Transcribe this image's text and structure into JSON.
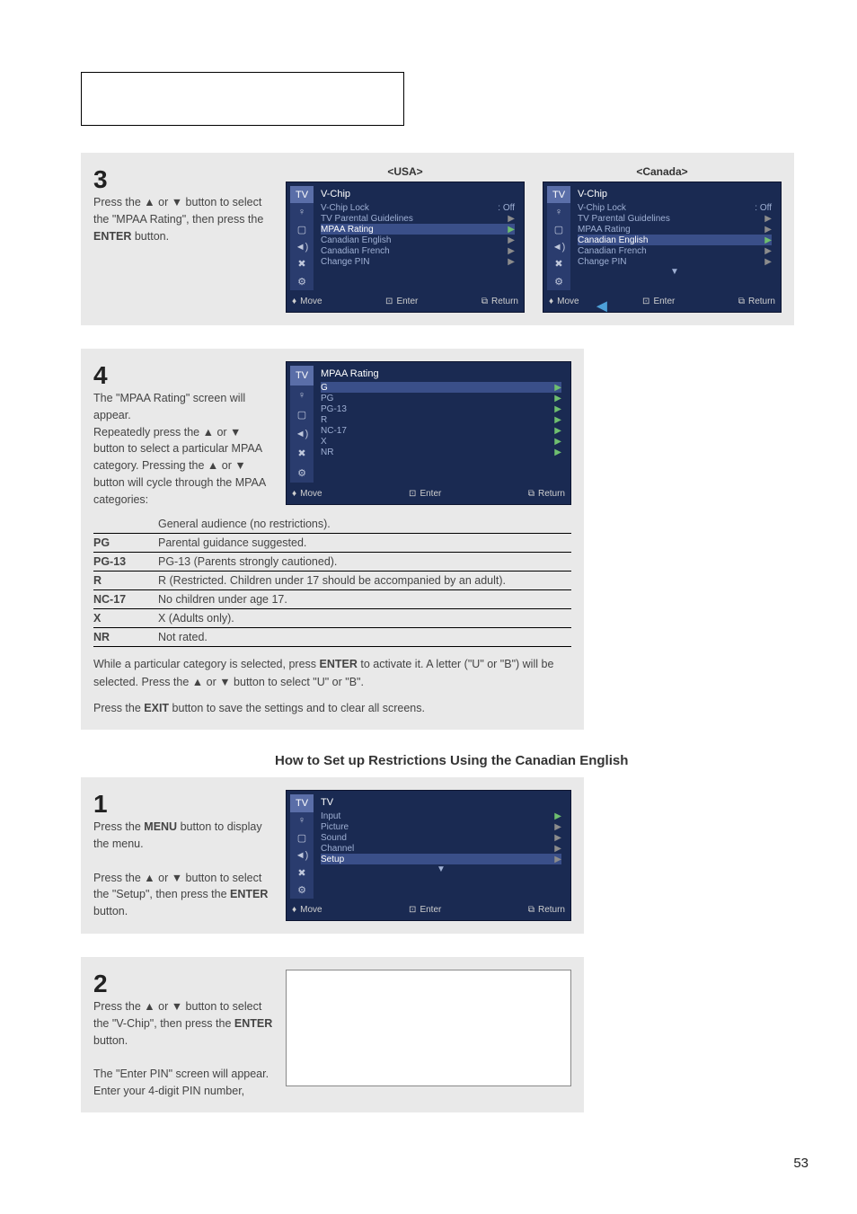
{
  "top_box": "",
  "step3": {
    "num": "3",
    "text_parts": [
      "Press the ▲ or ▼ button to select the \"MPAA Rating\", then press the ",
      " button."
    ],
    "bold": "ENTER",
    "usa_label": "<USA>",
    "canada_label": "<Canada>",
    "osd_usa": {
      "side_active": "TV",
      "title": "V-Chip",
      "lines": [
        {
          "l": "V-Chip Lock",
          "r": ": Off"
        },
        {
          "l": "TV Parental Guidelines",
          "r": "▶",
          "arrow": true
        },
        {
          "l": "MPAA Rating",
          "r": "▶",
          "sel": true,
          "arrow": true,
          "green": true
        },
        {
          "l": "Canadian English",
          "r": "▶",
          "arrow": true
        },
        {
          "l": "Canadian French",
          "r": "▶",
          "arrow": true
        },
        {
          "l": "Change PIN",
          "r": "▶",
          "arrow": true
        }
      ],
      "bottom": {
        "move": "Move",
        "enter": "Enter",
        "return": "Return"
      }
    },
    "osd_canada": {
      "side_active": "TV",
      "title": "V-Chip",
      "lines": [
        {
          "l": "V-Chip Lock",
          "r": ": Off"
        },
        {
          "l": "TV Parental Guidelines",
          "r": "▶",
          "arrow": true
        },
        {
          "l": "MPAA Rating",
          "r": "▶",
          "arrow": true
        },
        {
          "l": "Canadian English",
          "r": "▶",
          "sel": true,
          "arrow": true,
          "green": true
        },
        {
          "l": "Canadian French",
          "r": "▶",
          "arrow": true
        },
        {
          "l": "Change PIN",
          "r": "▶",
          "arrow": true
        }
      ],
      "sub": "▼",
      "bottom": {
        "move": "Move",
        "enter": "Enter",
        "return": "Return"
      }
    }
  },
  "step4": {
    "num": "4",
    "text": "The \"MPAA Rating\" screen will appear.\nRepeatedly press the ▲ or ▼ button to select a particular MPAA category. Pressing the ▲ or ▼ button will cycle through the MPAA categories:",
    "osd": {
      "title": "MPAA Rating",
      "lines": [
        {
          "l": "G",
          "r": "▶",
          "sel": true,
          "green": true
        },
        {
          "l": "PG",
          "r": "▶",
          "green": true
        },
        {
          "l": "PG-13",
          "r": "▶",
          "green": true
        },
        {
          "l": "R",
          "r": "▶",
          "green": true
        },
        {
          "l": "NC-17",
          "r": "▶",
          "green": true
        },
        {
          "l": "X",
          "r": "▶",
          "green": true
        },
        {
          "l": "NR",
          "r": "▶",
          "green": true
        }
      ],
      "bottom": {
        "move": "Move",
        "enter": "Enter",
        "return": "Return"
      }
    },
    "ratings": [
      {
        "code": "",
        "desc": "General audience (no restrictions)."
      },
      {
        "code": "PG",
        "desc": "Parental guidance suggested."
      },
      {
        "code": "PG-13",
        "desc": "PG-13 (Parents strongly cautioned)."
      },
      {
        "code": "R",
        "desc": "R (Restricted. Children under 17 should be accompanied by an adult)."
      },
      {
        "code": "NC-17",
        "desc": "No children under age 17."
      },
      {
        "code": "X",
        "desc": "X (Adults only)."
      },
      {
        "code": "NR",
        "desc": "Not rated."
      }
    ],
    "note1_parts": [
      "While a particular category is selected, press ",
      " to activate it. A letter (\"U\" or \"B\") will be selected. Press the ▲ or ▼ button to select \"U\" or \"B\"."
    ],
    "note1_bold": "ENTER",
    "note2_parts": [
      "Press the ",
      " button to save the settings and to clear all screens."
    ],
    "note2_bold": "EXIT"
  },
  "section_title": "How to Set up Restrictions Using the Canadian English",
  "step1b": {
    "num": "1",
    "t1a": "Press the ",
    "t1b": "MENU",
    "t1c": " button to display the menu.",
    "t2a": "Press the ▲ or ▼ button to select the \"Setup\", then press the ",
    "t2b": "ENTER",
    "t2c": " button.",
    "osd": {
      "title": "TV",
      "lines": [
        {
          "l": "Input",
          "r": "▶",
          "arrow": true,
          "green": true
        },
        {
          "l": "Picture",
          "r": "▶",
          "arrow": true
        },
        {
          "l": "Sound",
          "r": "▶",
          "arrow": true
        },
        {
          "l": "Channel",
          "r": "▶",
          "arrow": true
        },
        {
          "l": "Setup",
          "r": "▶",
          "sel": true,
          "arrow": true
        }
      ],
      "sub": "▼",
      "bottom": {
        "move": "Move",
        "enter": "Enter",
        "return": "Return"
      }
    }
  },
  "step2b": {
    "num": "2",
    "t1a": "Press the ▲ or ▼ button to  select  the \"V-Chip\", then press the ",
    "t1b": "ENTER",
    "t1c": " button.",
    "t2": "The \"Enter PIN\" screen will appear. Enter your 4-digit PIN number,"
  },
  "page_num": "53",
  "icons": {
    "tv": "TV",
    "antenna": "antenna",
    "screen": "screen",
    "speaker": "speaker",
    "tools": "tools",
    "sliders": "sliders"
  }
}
